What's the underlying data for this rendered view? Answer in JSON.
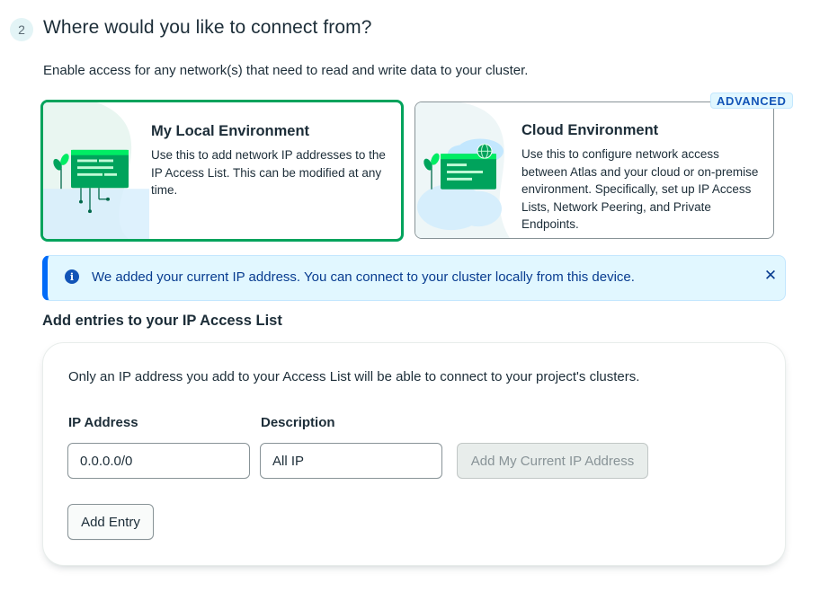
{
  "step": {
    "number": "2",
    "title": "Where would you like to connect from?",
    "subtitle": "Enable access for any network(s) that need to read and write data to your cluster."
  },
  "options": {
    "local": {
      "title": "My Local Environment",
      "description": "Use this to add network IP addresses to the IP Access List. This can be modified at any time.",
      "selected": true
    },
    "cloud": {
      "title": "Cloud Environment",
      "description": "Use this to configure network access between Atlas and your cloud or on-premise environment. Specifically, set up IP Access Lists, Network Peering, and Private Endpoints.",
      "badge": "ADVANCED",
      "selected": false
    }
  },
  "banner": {
    "icon": "info-icon",
    "text": "We added your current IP address. You can connect to your cluster locally from this device.",
    "close_icon": "close-icon"
  },
  "access_list": {
    "heading": "Add entries to your IP Access List",
    "intro": "Only an IP address you add to your Access List will be able to connect to your project's clusters.",
    "ip_label": "IP Address",
    "ip_value": "0.0.0.0/0",
    "description_label": "Description",
    "description_value": "All IP",
    "add_current_ip_label": "Add My Current IP Address",
    "add_entry_label": "Add Entry"
  },
  "colors": {
    "selected_border": "#00a35c",
    "banner_bg": "#e1f7ff",
    "banner_accent": "#016bf8",
    "text": "#1c2d38"
  }
}
